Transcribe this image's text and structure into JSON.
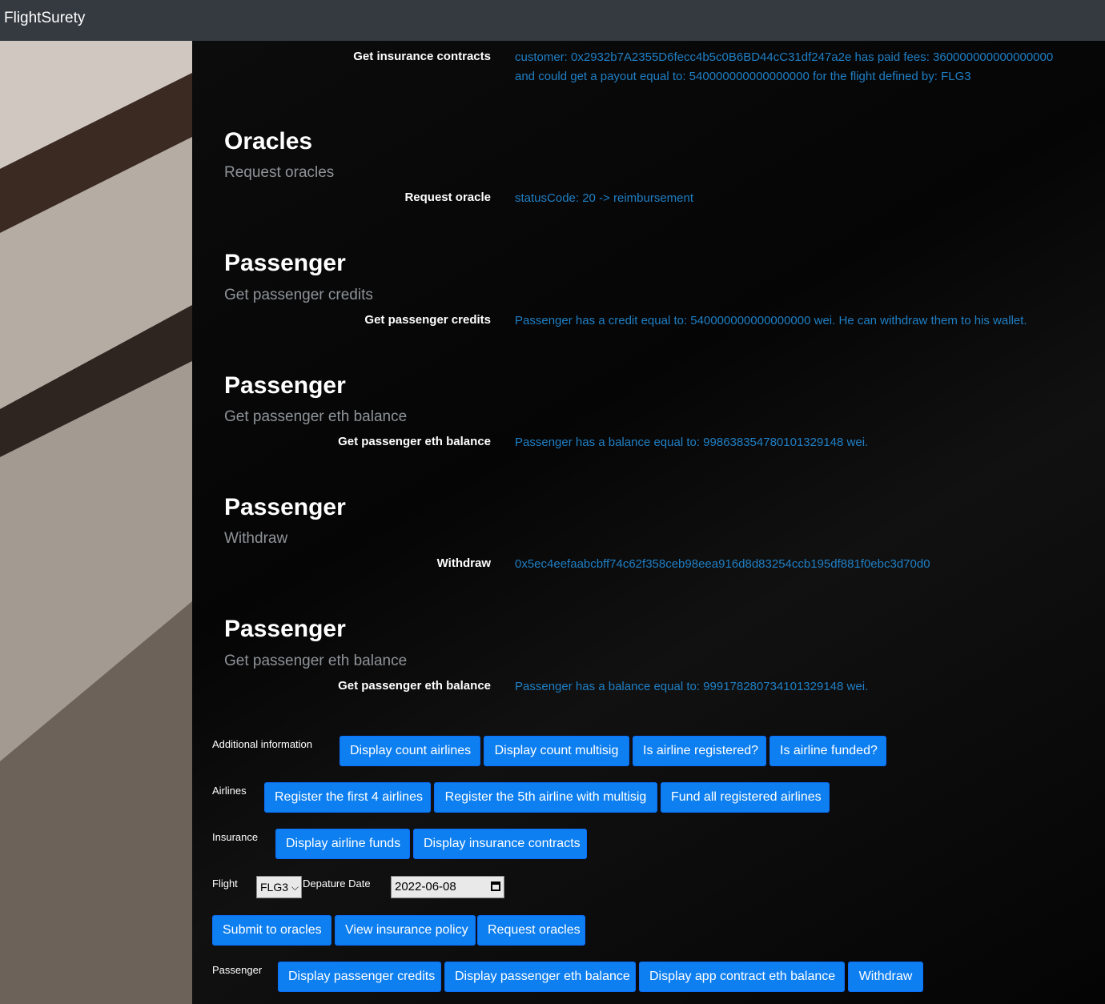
{
  "navbar": {
    "brand": "FlightSurety"
  },
  "rows": [
    {
      "label": "Get insurance contracts",
      "value_line1": "customer: 0x2932b7A2355D6fecc4b5c0B6BD44cC31df247a2e has paid fees: 360000000000000000",
      "value_line2": "and could get a payout equal to: 540000000000000000 for the flight defined by: FLG3"
    }
  ],
  "sections": [
    {
      "title": "Oracles",
      "subtitle": "Request oracles",
      "label": "Request oracle",
      "value": "statusCode: 20 -> reimbursement"
    },
    {
      "title": "Passenger",
      "subtitle": "Get passenger credits",
      "label": "Get passenger credits",
      "value": "Passenger has a credit equal to: 540000000000000000 wei. He can withdraw them to his wallet."
    },
    {
      "title": "Passenger",
      "subtitle": "Get passenger eth balance",
      "label": "Get passenger eth balance",
      "value": "Passenger has a balance equal to: 99863835478010132914​8 wei."
    },
    {
      "title": "Passenger",
      "subtitle": "Withdraw",
      "label": "Withdraw",
      "value": "0x5ec4eefaabcbff74c62f358ceb98eea916d8d83254ccb195df881f0ebc3d70d0"
    },
    {
      "title": "Passenger",
      "subtitle": "Get passenger eth balance",
      "label": "Get passenger eth balance",
      "value": "Passenger has a balance equal to: 999178280734101329148 wei."
    }
  ],
  "controls": {
    "additional": {
      "label": "Additional information",
      "buttons": [
        "Display count airlines",
        "Display count multisig",
        "Is airline registered?",
        "Is airline funded?"
      ]
    },
    "airlines": {
      "label": "Airlines",
      "buttons": [
        "Register the first 4 airlines",
        "Register the 5th airline with multisig",
        "Fund all registered airlines"
      ]
    },
    "insurance": {
      "label": "Insurance",
      "buttons": [
        "Display airline funds",
        "Display insurance contracts"
      ]
    },
    "flight": {
      "label": "Flight",
      "selected": "FLG3",
      "date_label": "Depature Date",
      "date_value": "2022-06-08"
    },
    "oracle_buttons": [
      "Submit to oracles",
      "View insurance policy",
      "Request oracles"
    ],
    "passenger": {
      "label": "Passenger",
      "buttons": [
        "Display passenger credits",
        "Display passenger eth balance",
        "Display app contract eth balance",
        "Withdraw"
      ]
    }
  }
}
